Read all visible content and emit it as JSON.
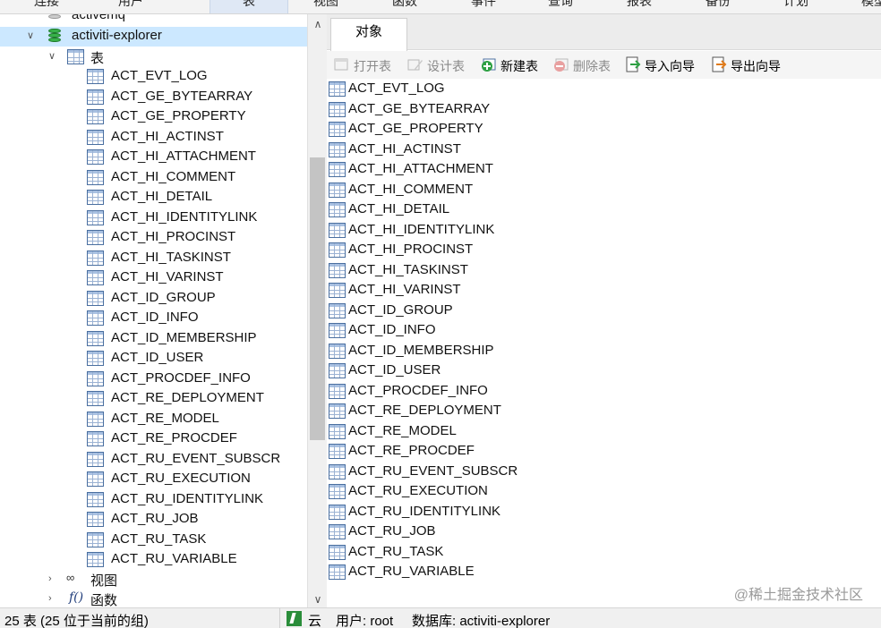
{
  "menubar": {
    "items": [
      "连接",
      "用户",
      "表",
      "视图",
      "函数",
      "事件",
      "查询",
      "报表",
      "备份",
      "计划",
      "模型"
    ]
  },
  "sidebar": {
    "prev_connection": "activemq",
    "connection": "activiti-explorer",
    "tables_node": "表",
    "tables": [
      "ACT_EVT_LOG",
      "ACT_GE_BYTEARRAY",
      "ACT_GE_PROPERTY",
      "ACT_HI_ACTINST",
      "ACT_HI_ATTACHMENT",
      "ACT_HI_COMMENT",
      "ACT_HI_DETAIL",
      "ACT_HI_IDENTITYLINK",
      "ACT_HI_PROCINST",
      "ACT_HI_TASKINST",
      "ACT_HI_VARINST",
      "ACT_ID_GROUP",
      "ACT_ID_INFO",
      "ACT_ID_MEMBERSHIP",
      "ACT_ID_USER",
      "ACT_PROCDEF_INFO",
      "ACT_RE_DEPLOYMENT",
      "ACT_RE_MODEL",
      "ACT_RE_PROCDEF",
      "ACT_RU_EVENT_SUBSCR",
      "ACT_RU_EXECUTION",
      "ACT_RU_IDENTITYLINK",
      "ACT_RU_JOB",
      "ACT_RU_TASK",
      "ACT_RU_VARIABLE"
    ],
    "views_node": "视图",
    "functions_node": "函数"
  },
  "main": {
    "tab": "对象",
    "toolbar": {
      "open": "打开表",
      "design": "设计表",
      "new": "新建表",
      "delete": "删除表",
      "import": "导入向导",
      "export": "导出向导"
    },
    "objects": [
      "ACT_EVT_LOG",
      "ACT_GE_BYTEARRAY",
      "ACT_GE_PROPERTY",
      "ACT_HI_ACTINST",
      "ACT_HI_ATTACHMENT",
      "ACT_HI_COMMENT",
      "ACT_HI_DETAIL",
      "ACT_HI_IDENTITYLINK",
      "ACT_HI_PROCINST",
      "ACT_HI_TASKINST",
      "ACT_HI_VARINST",
      "ACT_ID_GROUP",
      "ACT_ID_INFO",
      "ACT_ID_MEMBERSHIP",
      "ACT_ID_USER",
      "ACT_PROCDEF_INFO",
      "ACT_RE_DEPLOYMENT",
      "ACT_RE_MODEL",
      "ACT_RE_PROCDEF",
      "ACT_RU_EVENT_SUBSCR",
      "ACT_RU_EXECUTION",
      "ACT_RU_IDENTITYLINK",
      "ACT_RU_JOB",
      "ACT_RU_TASK",
      "ACT_RU_VARIABLE"
    ],
    "watermark": "@稀土掘金技术社区"
  },
  "status": {
    "count": "25 表 (25 位于当前的组)",
    "cloud": "云",
    "user": "用户: root",
    "database": "数据库: activiti-explorer"
  },
  "colors": {
    "selection": "#cce8ff",
    "db_green": "#38b24a"
  }
}
